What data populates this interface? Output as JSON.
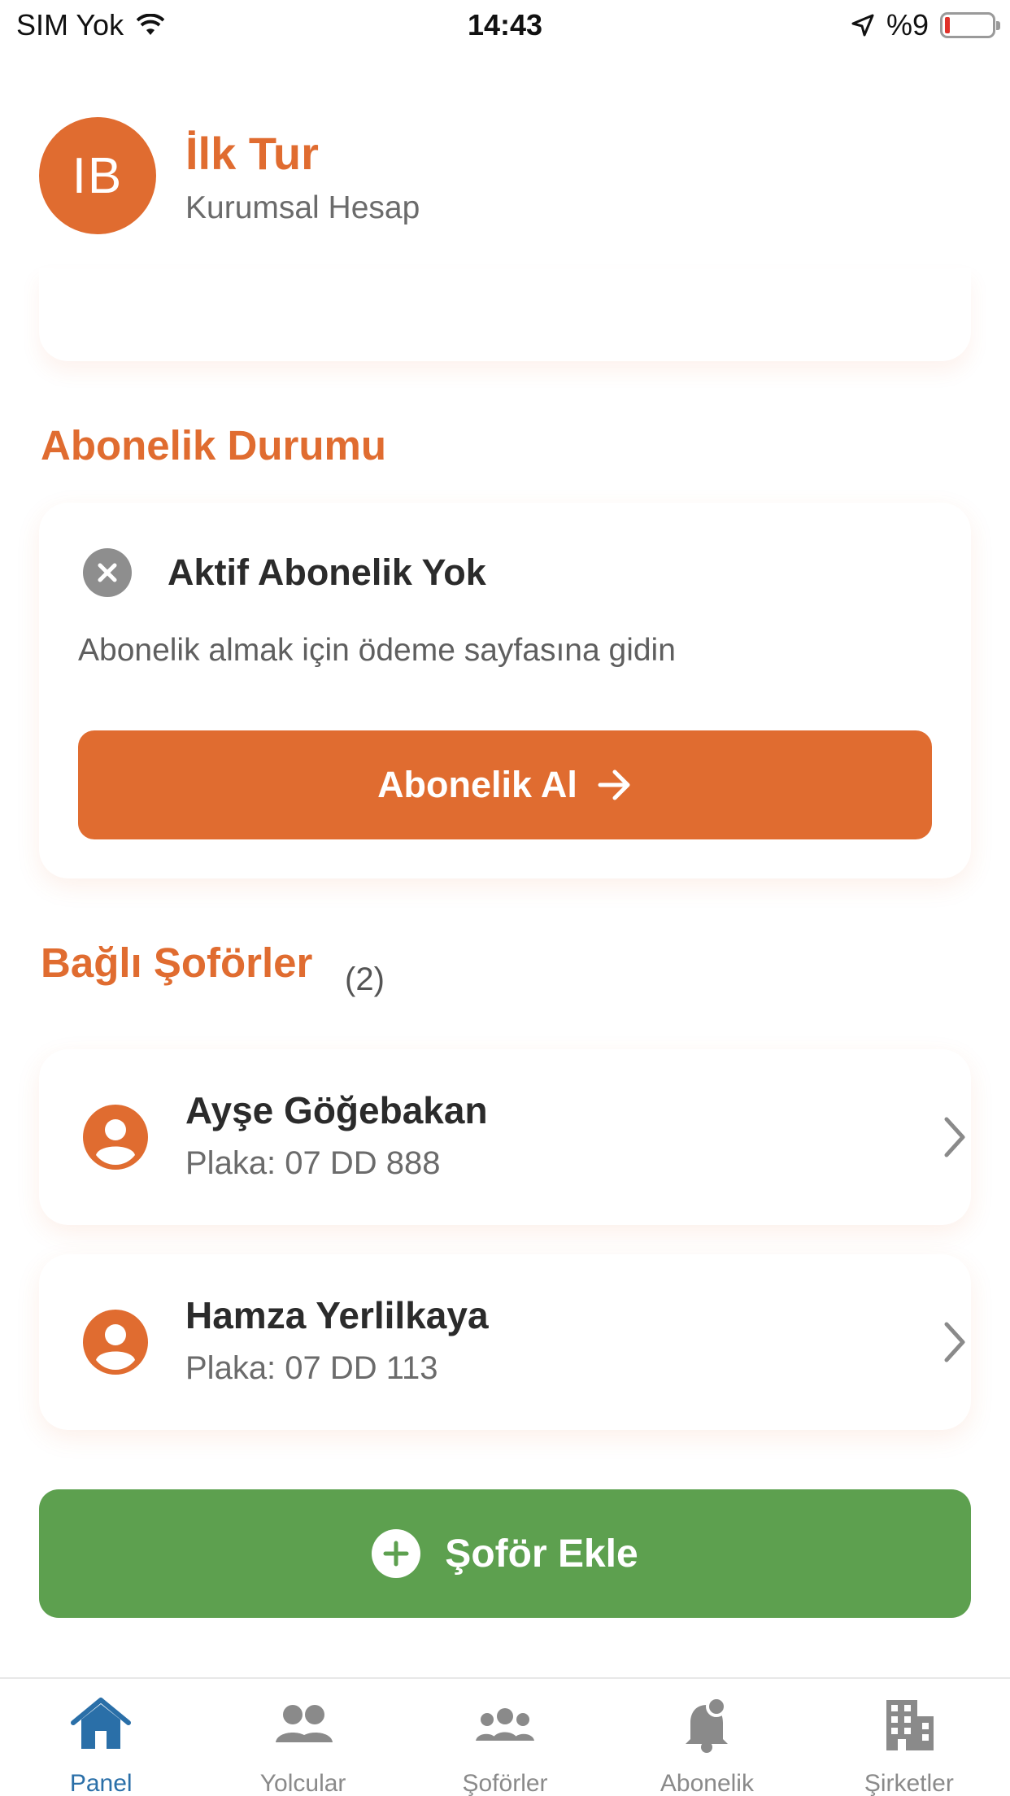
{
  "status_bar": {
    "carrier": "SIM Yok",
    "time": "14:43",
    "battery": "%9"
  },
  "profile": {
    "initials": "IB",
    "name": "İlk Tur",
    "account_type": "Kurumsal Hesap"
  },
  "subscription": {
    "section_title": "Abonelik Durumu",
    "status_title": "Aktif Abonelik Yok",
    "description": "Abonelik almak için ödeme sayfasına gidin",
    "button_label": "Abonelik Al"
  },
  "drivers": {
    "section_title": "Bağlı Şoförler",
    "count": "(2)",
    "items": [
      {
        "name": "Ayşe Göğebakan",
        "plate": "Plaka: 07 DD 888"
      },
      {
        "name": "Hamza Yerlilkaya",
        "plate": "Plaka: 07 DD 113"
      }
    ],
    "add_button_label": "Şoför Ekle"
  },
  "tab_bar": {
    "items": [
      {
        "label": "Panel",
        "icon": "home-icon",
        "active": true
      },
      {
        "label": "Yolcular",
        "icon": "passengers-icon",
        "active": false
      },
      {
        "label": "Şoförler",
        "icon": "drivers-icon",
        "active": false
      },
      {
        "label": "Abonelik",
        "icon": "bell-icon",
        "active": false
      },
      {
        "label": "Şirketler",
        "icon": "building-icon",
        "active": false
      }
    ]
  },
  "colors": {
    "accent": "#e06c30",
    "success": "#5da04f",
    "tab_active": "#2a6fa8",
    "tab_inactive": "#8a8a8a"
  }
}
